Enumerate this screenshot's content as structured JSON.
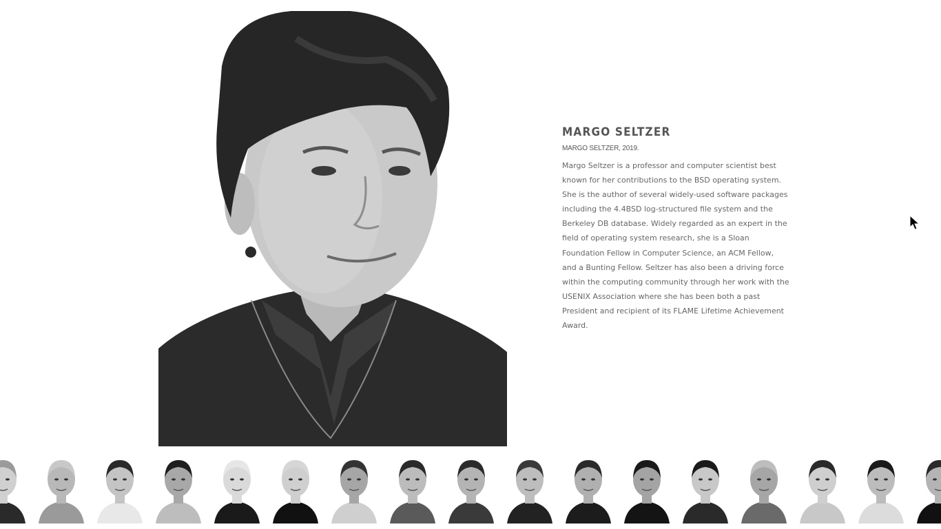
{
  "profile": {
    "name": "MARGO SELTZER",
    "caption": "MARGO SELTZER, 2019.",
    "bio": "Margo Seltzer is a professor and computer scientist best known for her contributions to the BSD operating system. She is the author of several widely-used software packages including the 4.4BSD log-structured file system and the Berkeley DB database. Widely regarded as an expert in the field of operating system research, she is a Sloan Foundation Fellow in Computer Science, an ACM Fellow, and a Bunting Fellow. Seltzer has also been a driving force within the computing community through her work with the USENIX Association where she has been both a past President and recipient of its FLAME Lifetime Achievement Award."
  },
  "thumbnails": [
    {
      "shirt": "#2a2a2a",
      "hair": "#9a9a9a",
      "skin": "#d0d0d0",
      "bg": "#ffffff"
    },
    {
      "shirt": "#9a9a9a",
      "hair": "#c8c8c8",
      "skin": "#b8b8b8",
      "bg": "#ffffff"
    },
    {
      "shirt": "#e8e8e8",
      "hair": "#2a2a2a",
      "skin": "#c4c4c4",
      "bg": "#ffffff"
    },
    {
      "shirt": "#bdbdbd",
      "hair": "#1e1e1e",
      "skin": "#a8a8a8",
      "bg": "#ffffff"
    },
    {
      "shirt": "#1a1a1a",
      "hair": "#e6e6e6",
      "skin": "#dadada",
      "bg": "#ffffff"
    },
    {
      "shirt": "#111111",
      "hair": "#d6d6d6",
      "skin": "#cfcfcf",
      "bg": "#ffffff"
    },
    {
      "shirt": "#cfcfcf",
      "hair": "#333333",
      "skin": "#a6a6a6",
      "bg": "#ffffff"
    },
    {
      "shirt": "#5a5a5a",
      "hair": "#2a2a2a",
      "skin": "#bcbcbc",
      "bg": "#ffffff"
    },
    {
      "shirt": "#3a3a3a",
      "hair": "#2a2a2a",
      "skin": "#b4b4b4",
      "bg": "#ffffff"
    },
    {
      "shirt": "#222222",
      "hair": "#3a3a3a",
      "skin": "#bdbdbd",
      "bg": "#ffffff"
    },
    {
      "shirt": "#1c1c1c",
      "hair": "#2a2a2a",
      "skin": "#b0b0b0",
      "bg": "#ffffff"
    },
    {
      "shirt": "#141414",
      "hair": "#1a1a1a",
      "skin": "#a4a4a4",
      "bg": "#ffffff"
    },
    {
      "shirt": "#2a2a2a",
      "hair": "#1a1a1a",
      "skin": "#c8c8c8",
      "bg": "#ffffff"
    },
    {
      "shirt": "#6a6a6a",
      "hair": "#bdbdbd",
      "skin": "#a6a6a6",
      "bg": "#ffffff"
    },
    {
      "shirt": "#c8c8c8",
      "hair": "#2a2a2a",
      "skin": "#cfcfcf",
      "bg": "#ffffff"
    },
    {
      "shirt": "#dcdcdc",
      "hair": "#1a1a1a",
      "skin": "#bcbcbc",
      "bg": "#ffffff"
    },
    {
      "shirt": "#111111",
      "hair": "#2a2a2a",
      "skin": "#b4b4b4",
      "bg": "#ffffff"
    }
  ]
}
